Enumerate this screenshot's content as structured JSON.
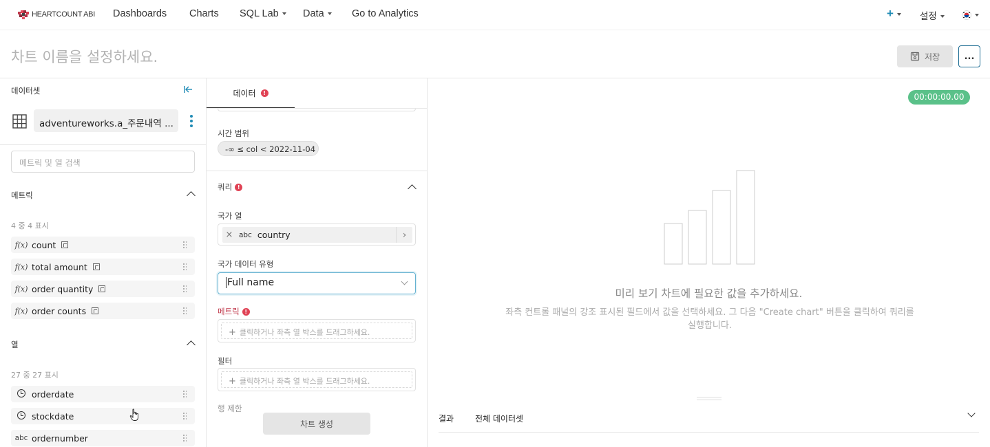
{
  "nav": {
    "brand": "HEARTCOUNT ABI",
    "links": [
      "Dashboards",
      "Charts",
      "SQL Lab",
      "Data",
      "Go to Analytics"
    ],
    "settings": "설정",
    "add_icon": "plus-icon",
    "language_icon": "korea-flag-icon"
  },
  "header": {
    "chart_title_placeholder": "차트 이름을 설정하세요.",
    "save_label": "저장",
    "more_label": "..."
  },
  "left": {
    "dataset_label": "데이터셋",
    "dataset_name": "adventureworks.a_주문내역 ...",
    "search_placeholder": "메트릭 및 열 검색",
    "metrics_label": "메트릭",
    "metrics_count": "4 중 4 표시",
    "metrics": [
      {
        "icon": "f(x)",
        "name": "count"
      },
      {
        "icon": "f(x)",
        "name": "total amount"
      },
      {
        "icon": "f(x)",
        "name": "order quantity"
      },
      {
        "icon": "f(x)",
        "name": "order counts"
      }
    ],
    "columns_label": "열",
    "columns_count": "27 중 27 표시",
    "columns": [
      {
        "icon": "clock",
        "name": "orderdate"
      },
      {
        "icon": "clock",
        "name": "stockdate"
      },
      {
        "icon": "abc",
        "name": "ordernumber"
      }
    ]
  },
  "mid": {
    "tab_label": "데이터",
    "time_range_label": "시간 범위",
    "time_range_value": "-∞ ≤ col < 2022-11-04",
    "query_label": "쿼리",
    "country_col_label": "국가 열",
    "country_col_type": "abc",
    "country_col_value": "country",
    "country_type_label": "국가 데이터 유형",
    "country_type_value": "Full name",
    "metric_label": "메트릭",
    "metric_placeholder": "클릭하거나 좌측 열 박스를 드래그하세요.",
    "filter_label": "필터",
    "filter_placeholder": "클릭하거나 좌측 열 박스를 드래그하세요.",
    "row_limit_label": "행 제한",
    "generate_label": "차트 생성"
  },
  "right": {
    "timer": "00:00:00.00",
    "empty_title": "미리 보기 차트에 필요한 값을 추가하세요.",
    "empty_desc": "좌측 컨트롤 패널의 강조 표시된 필드에서 값을 선택하세요. 그 다음 \"Create chart\" 버튼을 클릭하여 쿼리를 실행합니다.",
    "results_tab": "결과",
    "full_dataset_tab": "전체 데이터셋"
  }
}
